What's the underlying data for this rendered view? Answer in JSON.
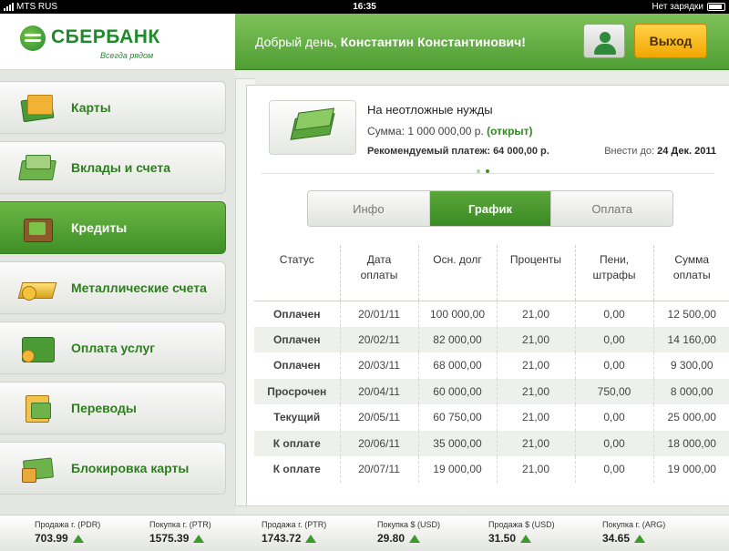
{
  "statusbar": {
    "carrier": "MTS RUS",
    "time": "16:35",
    "battery": "Нет зарядки"
  },
  "logo": {
    "name": "СБЕРБАНК",
    "slogan": "Всегда рядом"
  },
  "header": {
    "greeting": "Добрый день,",
    "user_name": "Константин Константинович!",
    "logout_label": "Выход"
  },
  "sidebar": {
    "items": [
      {
        "label": "Карты",
        "icon": "cards-icon"
      },
      {
        "label": "Вклады и счета",
        "icon": "deposits-icon"
      },
      {
        "label": "Кредиты",
        "icon": "credits-icon"
      },
      {
        "label": "Металлические счета",
        "icon": "gold-icon"
      },
      {
        "label": "Оплата услуг",
        "icon": "wallet-icon"
      },
      {
        "label": "Переводы",
        "icon": "transfer-icon"
      },
      {
        "label": "Блокировка карты",
        "icon": "card-lock-icon"
      }
    ],
    "active_index": 2
  },
  "loan": {
    "name": "На неотложные нужды",
    "sum_label": "Сумма:",
    "sum_value": "1 000 000,00 р.",
    "status": "(открыт)",
    "payment_label": "Рекомендуемый платеж:",
    "payment_value": "64 000,00 р.",
    "due_label": "Внести до:",
    "due_value": "24 Дек. 2011"
  },
  "tabs": [
    {
      "label": "Инфо"
    },
    {
      "label": "График"
    },
    {
      "label": "Оплата"
    }
  ],
  "active_tab": 1,
  "schedule": {
    "headers": {
      "status": "Статус",
      "date_1": "Дата",
      "date_2": "оплаты",
      "principal": "Осн. долг",
      "interest": "Проценты",
      "penalty_1": "Пени,",
      "penalty_2": "штрафы",
      "total_1": "Сумма",
      "total_2": "оплаты"
    },
    "rows": [
      {
        "status": "Оплачен",
        "kind": "paid",
        "date": "20/01/11",
        "principal": "100 000,00",
        "interest": "21,00",
        "penalty": "0,00",
        "total": "12 500,00"
      },
      {
        "status": "Оплачен",
        "kind": "paid",
        "date": "20/02/11",
        "principal": "82 000,00",
        "interest": "21,00",
        "penalty": "0,00",
        "total": "14 160,00"
      },
      {
        "status": "Оплачен",
        "kind": "paid",
        "date": "20/03/11",
        "principal": "68 000,00",
        "interest": "21,00",
        "penalty": "0,00",
        "total": "9 300,00"
      },
      {
        "status": "Просрочен",
        "kind": "overdue",
        "date": "20/04/11",
        "principal": "60 000,00",
        "interest": "21,00",
        "penalty": "750,00",
        "total": "8 000,00"
      },
      {
        "status": "Текущий",
        "kind": "current",
        "date": "20/05/11",
        "principal": "60 750,00",
        "interest": "21,00",
        "penalty": "0,00",
        "total": "25 000,00"
      },
      {
        "status": "К оплате",
        "kind": "due",
        "date": "20/06/11",
        "principal": "35 000,00",
        "interest": "21,00",
        "penalty": "0,00",
        "total": "18 000,00"
      },
      {
        "status": "К оплате",
        "kind": "due",
        "date": "20/07/11",
        "principal": "19 000,00",
        "interest": "21,00",
        "penalty": "0,00",
        "total": "19 000,00"
      }
    ]
  },
  "ticker": [
    {
      "label": "Продажа г. (PDR)",
      "value": "703.99"
    },
    {
      "label": "Покупка г. (PTR)",
      "value": "1575.39"
    },
    {
      "label": "Продажа г. (PTR)",
      "value": "1743.72"
    },
    {
      "label": "Покупка $ (USD)",
      "value": "29.80"
    },
    {
      "label": "Продажа $ (USD)",
      "value": "31.50"
    },
    {
      "label": "Покупка г. (ARG)",
      "value": "34.65"
    }
  ],
  "colors": {
    "brand_green": "#1f8a2b",
    "active_green": "#3f8f27",
    "logout_yellow": "#f2a600",
    "overdue_red": "#c0474a",
    "current_yellow": "#d7a21a",
    "due_purple": "#5a56a6"
  }
}
